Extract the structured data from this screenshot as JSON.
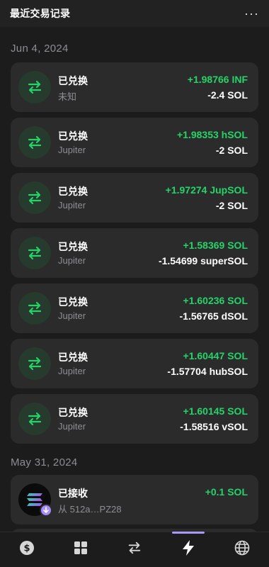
{
  "header": {
    "title": "最近交易记录",
    "more_label": "···"
  },
  "sections": [
    {
      "date": "Jun 4, 2024",
      "items": [
        {
          "name": "已兑换",
          "sub": "未知",
          "amount_in": "+1.98766 INF",
          "amount_out": "-2.4 SOL"
        },
        {
          "name": "已兑换",
          "sub": "Jupiter",
          "amount_in": "+1.98353 hSOL",
          "amount_out": "-2 SOL"
        },
        {
          "name": "已兑换",
          "sub": "Jupiter",
          "amount_in": "+1.97274 JupSOL",
          "amount_out": "-2 SOL"
        },
        {
          "name": "已兑换",
          "sub": "Jupiter",
          "amount_in": "+1.58369 SOL",
          "amount_out": "-1.54699 superSOL"
        },
        {
          "name": "已兑换",
          "sub": "Jupiter",
          "amount_in": "+1.60236 SOL",
          "amount_out": "-1.56765 dSOL"
        },
        {
          "name": "已兑换",
          "sub": "Jupiter",
          "amount_in": "+1.60447 SOL",
          "amount_out": "-1.57704 hubSOL"
        },
        {
          "name": "已兑换",
          "sub": "Jupiter",
          "amount_in": "+1.60145 SOL",
          "amount_out": "-1.58516 vSOL"
        }
      ]
    },
    {
      "date": "May 31, 2024",
      "items": [
        {
          "name": "已接收",
          "sub": "从 512a…PZ28",
          "amount_in": "+0.1 SOL"
        }
      ]
    }
  ],
  "colors": {
    "positive": "#24d468",
    "accent": "#a99af6",
    "icon_bg": "#263a2d"
  },
  "icons": {
    "swap": "swap-arrows-icon",
    "more": "more-dots-icon"
  },
  "tabs": [
    {
      "icon": "dollar-icon",
      "active": false
    },
    {
      "icon": "grid-icon",
      "active": false
    },
    {
      "icon": "swap-arrows-icon",
      "active": false
    },
    {
      "icon": "lightning-icon",
      "active": true
    },
    {
      "icon": "globe-icon",
      "active": false
    }
  ]
}
